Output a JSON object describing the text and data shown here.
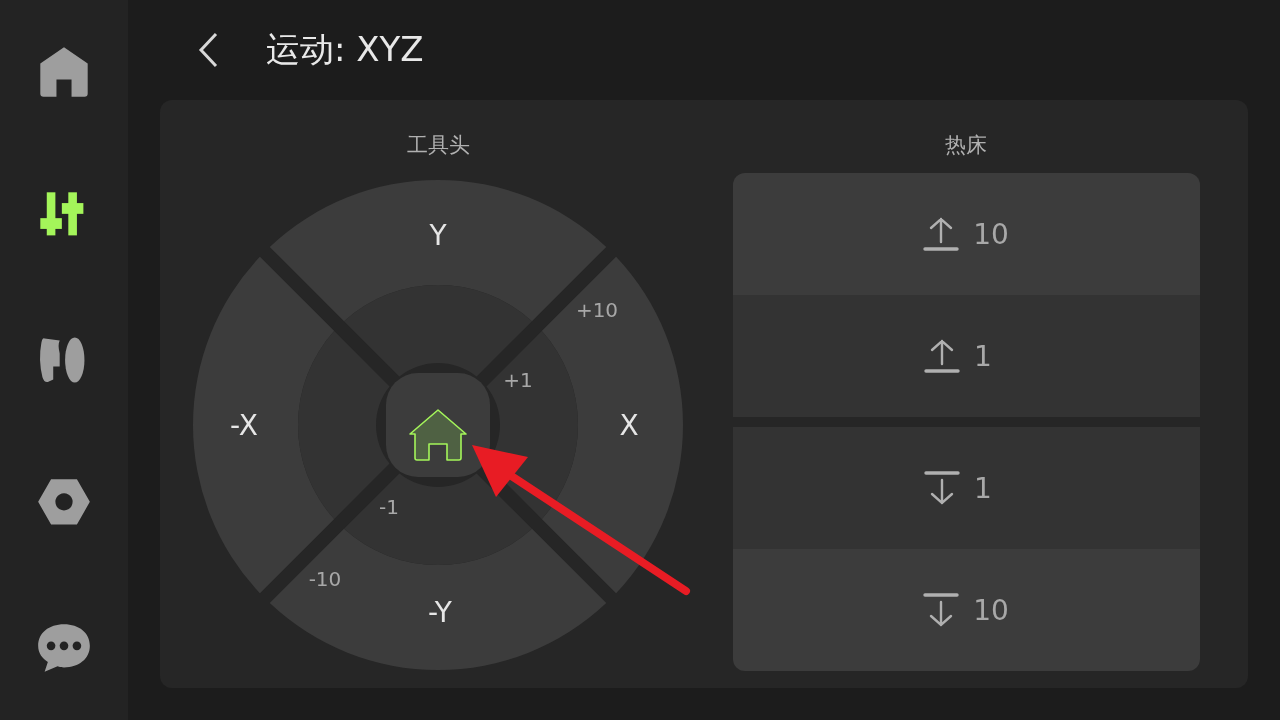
{
  "sidebar": {
    "items": [
      {
        "kind": "home",
        "selected": false
      },
      {
        "kind": "motion",
        "selected": true
      },
      {
        "kind": "filament",
        "selected": false
      },
      {
        "kind": "settings",
        "selected": false
      },
      {
        "kind": "console",
        "selected": false
      }
    ]
  },
  "header": {
    "title": "运动: XYZ"
  },
  "toolhead": {
    "title": "工具头",
    "axes": [
      {
        "label": "Y"
      },
      {
        "label": "X"
      },
      {
        "label": "-Y"
      },
      {
        "label": "-X"
      }
    ],
    "steps": [
      {
        "label": "+10"
      },
      {
        "label": "+1"
      },
      {
        "label": "-1"
      },
      {
        "label": "-10"
      }
    ]
  },
  "bed": {
    "title": "热床",
    "raise_buttons": [
      {
        "label": "10"
      },
      {
        "label": "1"
      }
    ],
    "lower_buttons": [
      {
        "label": "1"
      },
      {
        "label": "10"
      }
    ]
  }
}
